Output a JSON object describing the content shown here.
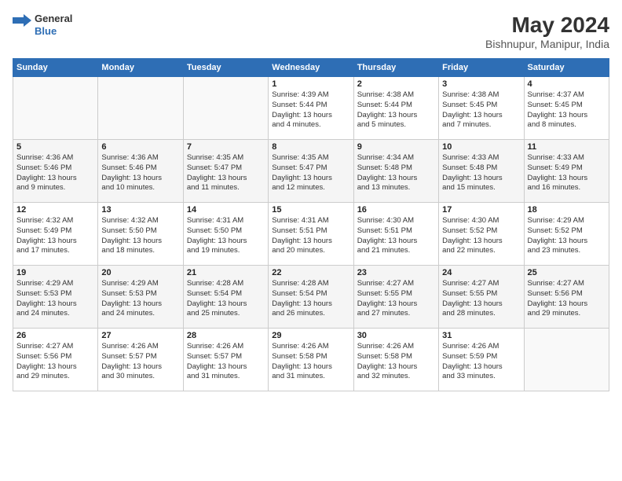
{
  "header": {
    "logo": {
      "line1": "General",
      "line2": "Blue"
    },
    "title": "May 2024",
    "location": "Bishnupur, Manipur, India"
  },
  "weekdays": [
    "Sunday",
    "Monday",
    "Tuesday",
    "Wednesday",
    "Thursday",
    "Friday",
    "Saturday"
  ],
  "weeks": [
    [
      {
        "day": "",
        "info": ""
      },
      {
        "day": "",
        "info": ""
      },
      {
        "day": "",
        "info": ""
      },
      {
        "day": "1",
        "info": "Sunrise: 4:39 AM\nSunset: 5:44 PM\nDaylight: 13 hours\nand 4 minutes."
      },
      {
        "day": "2",
        "info": "Sunrise: 4:38 AM\nSunset: 5:44 PM\nDaylight: 13 hours\nand 5 minutes."
      },
      {
        "day": "3",
        "info": "Sunrise: 4:38 AM\nSunset: 5:45 PM\nDaylight: 13 hours\nand 7 minutes."
      },
      {
        "day": "4",
        "info": "Sunrise: 4:37 AM\nSunset: 5:45 PM\nDaylight: 13 hours\nand 8 minutes."
      }
    ],
    [
      {
        "day": "5",
        "info": "Sunrise: 4:36 AM\nSunset: 5:46 PM\nDaylight: 13 hours\nand 9 minutes."
      },
      {
        "day": "6",
        "info": "Sunrise: 4:36 AM\nSunset: 5:46 PM\nDaylight: 13 hours\nand 10 minutes."
      },
      {
        "day": "7",
        "info": "Sunrise: 4:35 AM\nSunset: 5:47 PM\nDaylight: 13 hours\nand 11 minutes."
      },
      {
        "day": "8",
        "info": "Sunrise: 4:35 AM\nSunset: 5:47 PM\nDaylight: 13 hours\nand 12 minutes."
      },
      {
        "day": "9",
        "info": "Sunrise: 4:34 AM\nSunset: 5:48 PM\nDaylight: 13 hours\nand 13 minutes."
      },
      {
        "day": "10",
        "info": "Sunrise: 4:33 AM\nSunset: 5:48 PM\nDaylight: 13 hours\nand 15 minutes."
      },
      {
        "day": "11",
        "info": "Sunrise: 4:33 AM\nSunset: 5:49 PM\nDaylight: 13 hours\nand 16 minutes."
      }
    ],
    [
      {
        "day": "12",
        "info": "Sunrise: 4:32 AM\nSunset: 5:49 PM\nDaylight: 13 hours\nand 17 minutes."
      },
      {
        "day": "13",
        "info": "Sunrise: 4:32 AM\nSunset: 5:50 PM\nDaylight: 13 hours\nand 18 minutes."
      },
      {
        "day": "14",
        "info": "Sunrise: 4:31 AM\nSunset: 5:50 PM\nDaylight: 13 hours\nand 19 minutes."
      },
      {
        "day": "15",
        "info": "Sunrise: 4:31 AM\nSunset: 5:51 PM\nDaylight: 13 hours\nand 20 minutes."
      },
      {
        "day": "16",
        "info": "Sunrise: 4:30 AM\nSunset: 5:51 PM\nDaylight: 13 hours\nand 21 minutes."
      },
      {
        "day": "17",
        "info": "Sunrise: 4:30 AM\nSunset: 5:52 PM\nDaylight: 13 hours\nand 22 minutes."
      },
      {
        "day": "18",
        "info": "Sunrise: 4:29 AM\nSunset: 5:52 PM\nDaylight: 13 hours\nand 23 minutes."
      }
    ],
    [
      {
        "day": "19",
        "info": "Sunrise: 4:29 AM\nSunset: 5:53 PM\nDaylight: 13 hours\nand 24 minutes."
      },
      {
        "day": "20",
        "info": "Sunrise: 4:29 AM\nSunset: 5:53 PM\nDaylight: 13 hours\nand 24 minutes."
      },
      {
        "day": "21",
        "info": "Sunrise: 4:28 AM\nSunset: 5:54 PM\nDaylight: 13 hours\nand 25 minutes."
      },
      {
        "day": "22",
        "info": "Sunrise: 4:28 AM\nSunset: 5:54 PM\nDaylight: 13 hours\nand 26 minutes."
      },
      {
        "day": "23",
        "info": "Sunrise: 4:27 AM\nSunset: 5:55 PM\nDaylight: 13 hours\nand 27 minutes."
      },
      {
        "day": "24",
        "info": "Sunrise: 4:27 AM\nSunset: 5:55 PM\nDaylight: 13 hours\nand 28 minutes."
      },
      {
        "day": "25",
        "info": "Sunrise: 4:27 AM\nSunset: 5:56 PM\nDaylight: 13 hours\nand 29 minutes."
      }
    ],
    [
      {
        "day": "26",
        "info": "Sunrise: 4:27 AM\nSunset: 5:56 PM\nDaylight: 13 hours\nand 29 minutes."
      },
      {
        "day": "27",
        "info": "Sunrise: 4:26 AM\nSunset: 5:57 PM\nDaylight: 13 hours\nand 30 minutes."
      },
      {
        "day": "28",
        "info": "Sunrise: 4:26 AM\nSunset: 5:57 PM\nDaylight: 13 hours\nand 31 minutes."
      },
      {
        "day": "29",
        "info": "Sunrise: 4:26 AM\nSunset: 5:58 PM\nDaylight: 13 hours\nand 31 minutes."
      },
      {
        "day": "30",
        "info": "Sunrise: 4:26 AM\nSunset: 5:58 PM\nDaylight: 13 hours\nand 32 minutes."
      },
      {
        "day": "31",
        "info": "Sunrise: 4:26 AM\nSunset: 5:59 PM\nDaylight: 13 hours\nand 33 minutes."
      },
      {
        "day": "",
        "info": ""
      }
    ]
  ]
}
